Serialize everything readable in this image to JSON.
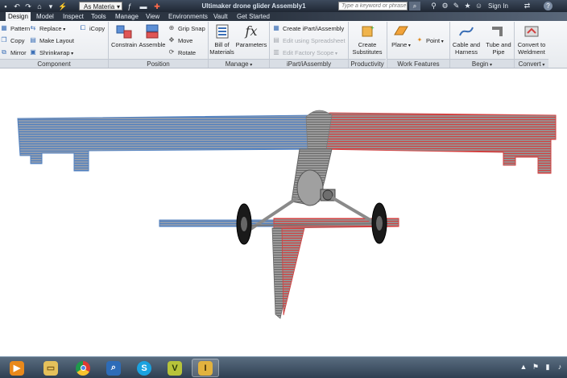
{
  "titlebar": {
    "material_label": "As Materia",
    "document_title": "Ultimaker drone glider Assembly1",
    "search_placeholder": "Type a keyword or phrase",
    "signin_label": "Sign In",
    "help_label": "?"
  },
  "menu": {
    "tabs": [
      "Design",
      "Model",
      "Inspect",
      "Tools",
      "Manage",
      "View",
      "Environments",
      "Vault",
      "Get Started"
    ],
    "active_tab": "Design"
  },
  "ribbon": {
    "component": {
      "label": "Component",
      "pattern": "Pattern",
      "copy": "Copy",
      "mirror": "Mirror",
      "replace": "Replace",
      "make_layout": "Make Layout",
      "shrinkwrap": "Shrinkwrap",
      "icopy": "iCopy"
    },
    "position": {
      "label": "Position",
      "constrain": "Constrain",
      "assemble": "Assemble",
      "grip_snap": "Grip Snap",
      "move": "Move",
      "rotate": "Rotate"
    },
    "manage": {
      "label": "Manage",
      "bill_line1": "Bill of",
      "bill_line2": "Materials",
      "parameters": "Parameters"
    },
    "ipart": {
      "label": "iPart/iAssembly",
      "create": "Create iPart/iAssembly",
      "edit_spreadsheet": "Edit using Spreadsheet",
      "edit_factory": "Edit Factory Scope"
    },
    "productivity": {
      "label": "Productivity",
      "create_line1": "Create",
      "create_line2": "Substitutes"
    },
    "work_features": {
      "label": "Work Features",
      "plane": "Plane",
      "point": "Point"
    },
    "begin": {
      "label": "Begin",
      "cable_line1": "Cable and",
      "cable_line2": "Harness",
      "tube_line1": "Tube and",
      "tube_line2": "Pipe"
    },
    "convert": {
      "label": "Convert",
      "convert_line1": "Convert to",
      "convert_line2": "Weldment"
    }
  },
  "colors": {
    "model_blue": "#4f7fbf",
    "model_red": "#d24040",
    "model_grey": "#8f8f8f"
  }
}
